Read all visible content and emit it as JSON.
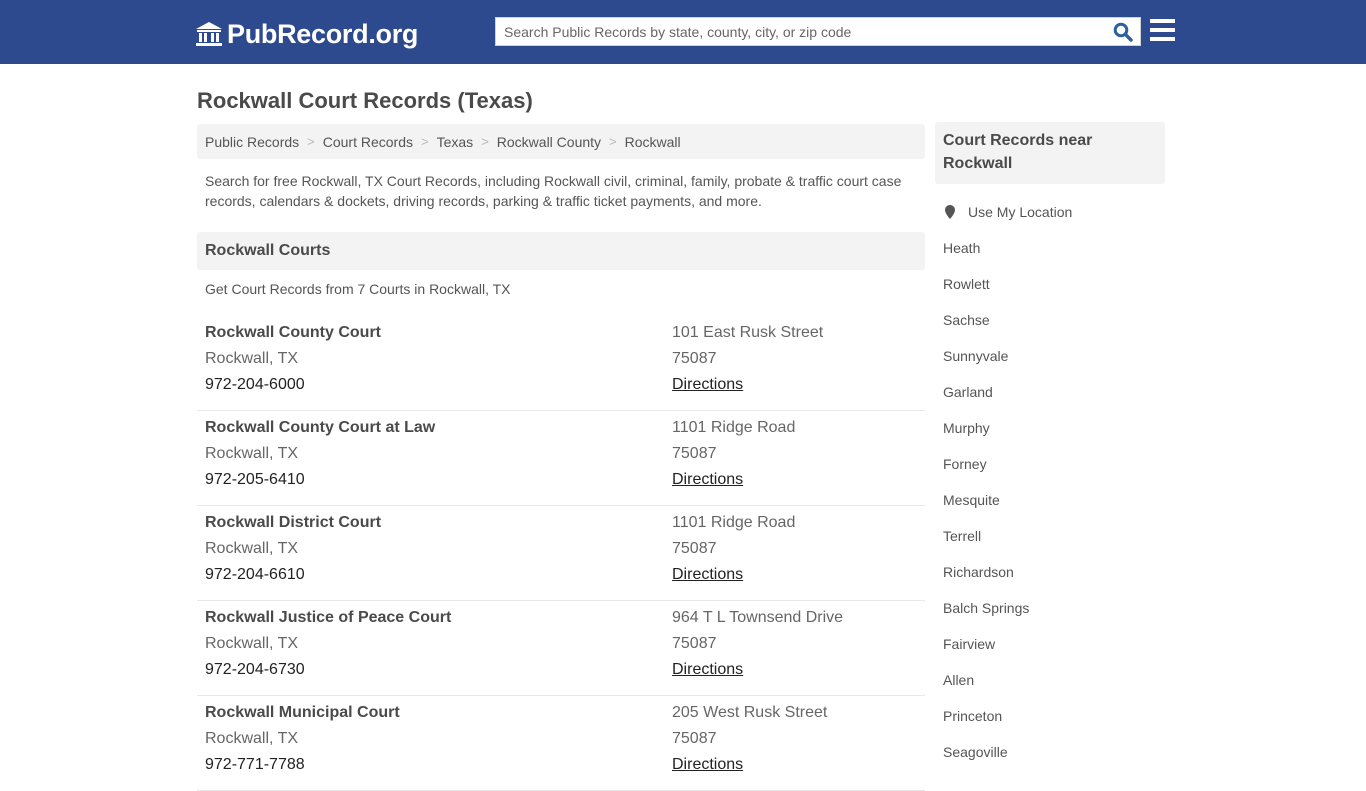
{
  "header": {
    "logo_text": "PubRecord.org",
    "logo_icon": "courthouse-icon",
    "search_placeholder": "Search Public Records by state, county, city, or zip code",
    "search_value": "",
    "search_icon": "search-icon",
    "menu_icon": "hamburger-menu-icon",
    "colors": {
      "bar": "#2e4a8e",
      "search_icon": "#2e5f9e"
    }
  },
  "page": {
    "title": "Rockwall Court Records (Texas)",
    "breadcrumb": [
      "Public Records",
      "Court Records",
      "Texas",
      "Rockwall County",
      "Rockwall"
    ],
    "breadcrumb_separator": ">",
    "intro": "Search for free Rockwall, TX Court Records, including Rockwall civil, criminal, family, probate & traffic court case records, calendars & dockets, driving records, parking & traffic ticket payments, and more."
  },
  "courts_section": {
    "header": "Rockwall Courts",
    "subheader": "Get Court Records from 7 Courts in Rockwall, TX",
    "courts": [
      {
        "name": "Rockwall County Court",
        "city": "Rockwall, TX",
        "phone": "972-204-6000",
        "address": "101 East Rusk Street",
        "zip": "75087",
        "directions": "Directions"
      },
      {
        "name": "Rockwall County Court at Law",
        "city": "Rockwall, TX",
        "phone": "972-205-6410",
        "address": "1101 Ridge Road",
        "zip": "75087",
        "directions": "Directions"
      },
      {
        "name": "Rockwall District Court",
        "city": "Rockwall, TX",
        "phone": "972-204-6610",
        "address": "1101 Ridge Road",
        "zip": "75087",
        "directions": "Directions"
      },
      {
        "name": "Rockwall Justice of Peace Court",
        "city": "Rockwall, TX",
        "phone": "972-204-6730",
        "address": "964 T L Townsend Drive",
        "zip": "75087",
        "directions": "Directions"
      },
      {
        "name": "Rockwall Municipal Court",
        "city": "Rockwall, TX",
        "phone": "972-771-7788",
        "address": "205 West Rusk Street",
        "zip": "75087",
        "directions": "Directions"
      }
    ]
  },
  "sidebar": {
    "header": "Court Records near Rockwall",
    "use_location": "Use My Location",
    "use_location_icon": "map-pin-icon",
    "nearby": [
      "Heath",
      "Rowlett",
      "Sachse",
      "Sunnyvale",
      "Garland",
      "Murphy",
      "Forney",
      "Mesquite",
      "Terrell",
      "Richardson",
      "Balch Springs",
      "Fairview",
      "Allen",
      "Princeton",
      "Seagoville"
    ]
  }
}
